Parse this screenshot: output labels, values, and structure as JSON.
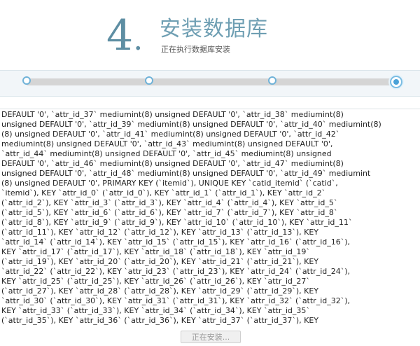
{
  "header": {
    "step_number": "4",
    "title": "安装数据库",
    "subtitle": "正在执行数据库安装"
  },
  "progress": {
    "steps": 4,
    "current_step": 4,
    "accent_color": "#4aa2d8"
  },
  "log": {
    "lines": [
      "DEFAULT '0', `attr_id_37` mediumint(8) unsigned DEFAULT '0', `attr_id_38` mediumint(8)",
      "unsigned DEFAULT '0', `attr_id_39` mediumint(8) unsigned DEFAULT '0', `attr_id_40` mediumint(8)",
      "(8) unsigned DEFAULT '0', `attr_id_41` mediumint(8) unsigned DEFAULT '0', `attr_id_42`",
      "mediumint(8) unsigned DEFAULT '0', `attr_id_43` mediumint(8) unsigned DEFAULT '0',",
      "`attr_id_44` mediumint(8) unsigned DEFAULT '0', `attr_id_45` mediumint(8) unsigned",
      "DEFAULT '0', `attr_id_46` mediumint(8) unsigned DEFAULT '0', `attr_id_47` mediumint(8)",
      "unsigned DEFAULT '0', `attr_id_48` mediumint(8) unsigned DEFAULT '0', `attr_id_49` mediumint",
      "(8) unsigned DEFAULT '0', PRIMARY KEY (`itemid`), UNIQUE KEY `catid_itemid` (`catid`,",
      "`itemid`), KEY `attr_id_0` (`attr_id_0`), KEY `attr_id_1` (`attr_id_1`), KEY `attr_id_2`",
      "(`attr_id_2`), KEY `attr_id_3` (`attr_id_3`), KEY `attr_id_4` (`attr_id_4`), KEY `attr_id_5`",
      "(`attr_id_5`), KEY `attr_id_6` (`attr_id_6`), KEY `attr_id_7` (`attr_id_7`), KEY `attr_id_8`",
      "(`attr_id_8`), KEY `attr_id_9` (`attr_id_9`), KEY `attr_id_10` (`attr_id_10`), KEY `attr_id_11`",
      "(`attr_id_11`), KEY `attr_id_12` (`attr_id_12`), KEY `attr_id_13` (`attr_id_13`), KEY",
      "`attr_id_14` (`attr_id_14`), KEY `attr_id_15` (`attr_id_15`), KEY `attr_id_16` (`attr_id_16`),",
      "KEY `attr_id_17` (`attr_id_17`), KEY `attr_id_18` (`attr_id_18`), KEY `attr_id_19`",
      "(`attr_id_19`), KEY `attr_id_20` (`attr_id_20`), KEY `attr_id_21` (`attr_id_21`), KEY",
      "`attr_id_22` (`attr_id_22`), KEY `attr_id_23` (`attr_id_23`), KEY `attr_id_24` (`attr_id_24`),",
      "KEY `attr_id_25` (`attr_id_25`), KEY `attr_id_26` (`attr_id_26`), KEY `attr_id_27`",
      "(`attr_id_27`), KEY `attr_id_28` (`attr_id_28`), KEY `attr_id_29` (`attr_id_29`), KEY",
      "`attr_id_30` (`attr_id_30`), KEY `attr_id_31` (`attr_id_31`), KEY `attr_id_32` (`attr_id_32`),",
      "KEY `attr_id_33` (`attr_id_33`), KEY `attr_id_34` (`attr_id_34`), KEY `attr_id_35`",
      "(`attr_id_35`), KEY `attr_id_36` (`attr_id_36`), KEY `attr_id_37` (`attr_id_37`), KEY"
    ]
  },
  "footer": {
    "install_button_label": "正在安装..."
  }
}
